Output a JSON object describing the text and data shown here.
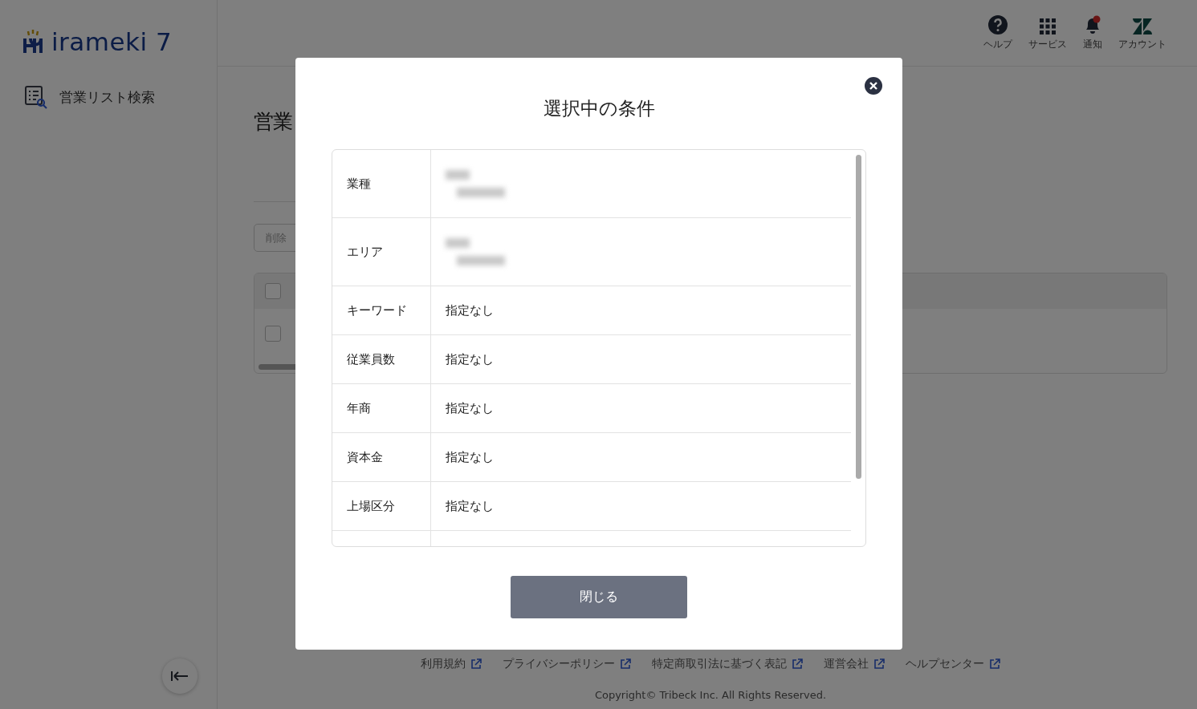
{
  "sidebar": {
    "logo": "irameki 7",
    "items": [
      {
        "label": "営業リスト検索"
      }
    ]
  },
  "header": {
    "items": [
      {
        "kind": "help",
        "label": "ヘルプ"
      },
      {
        "kind": "services",
        "label": "サービス"
      },
      {
        "kind": "notification",
        "label": "通知",
        "unread": true
      },
      {
        "kind": "account",
        "label": "アカウント"
      }
    ]
  },
  "page": {
    "title": "営業",
    "delete_button": "削除",
    "table": {
      "header_checked": false,
      "rows": [
        {
          "checked": false
        }
      ]
    }
  },
  "footer": {
    "links": [
      "利用規約",
      "プライバシーポリシー",
      "特定商取引法に基づく表記",
      "運営会社",
      "ヘルプセンター"
    ],
    "copyright": "Copyright© Tribeck Inc. All Rights Reserved."
  },
  "modal": {
    "title": "選択中の条件",
    "rows": [
      {
        "label": "業種",
        "kind": "blurred"
      },
      {
        "label": "エリア",
        "kind": "blurred"
      },
      {
        "label": "キーワード",
        "kind": "text",
        "value": "指定なし"
      },
      {
        "label": "従業員数",
        "kind": "text",
        "value": "指定なし"
      },
      {
        "label": "年商",
        "kind": "text",
        "value": "指定なし"
      },
      {
        "label": "資本金",
        "kind": "text",
        "value": "指定なし"
      },
      {
        "label": "上場区分",
        "kind": "text",
        "value": "指定なし"
      }
    ],
    "close_button": "閉じる"
  }
}
